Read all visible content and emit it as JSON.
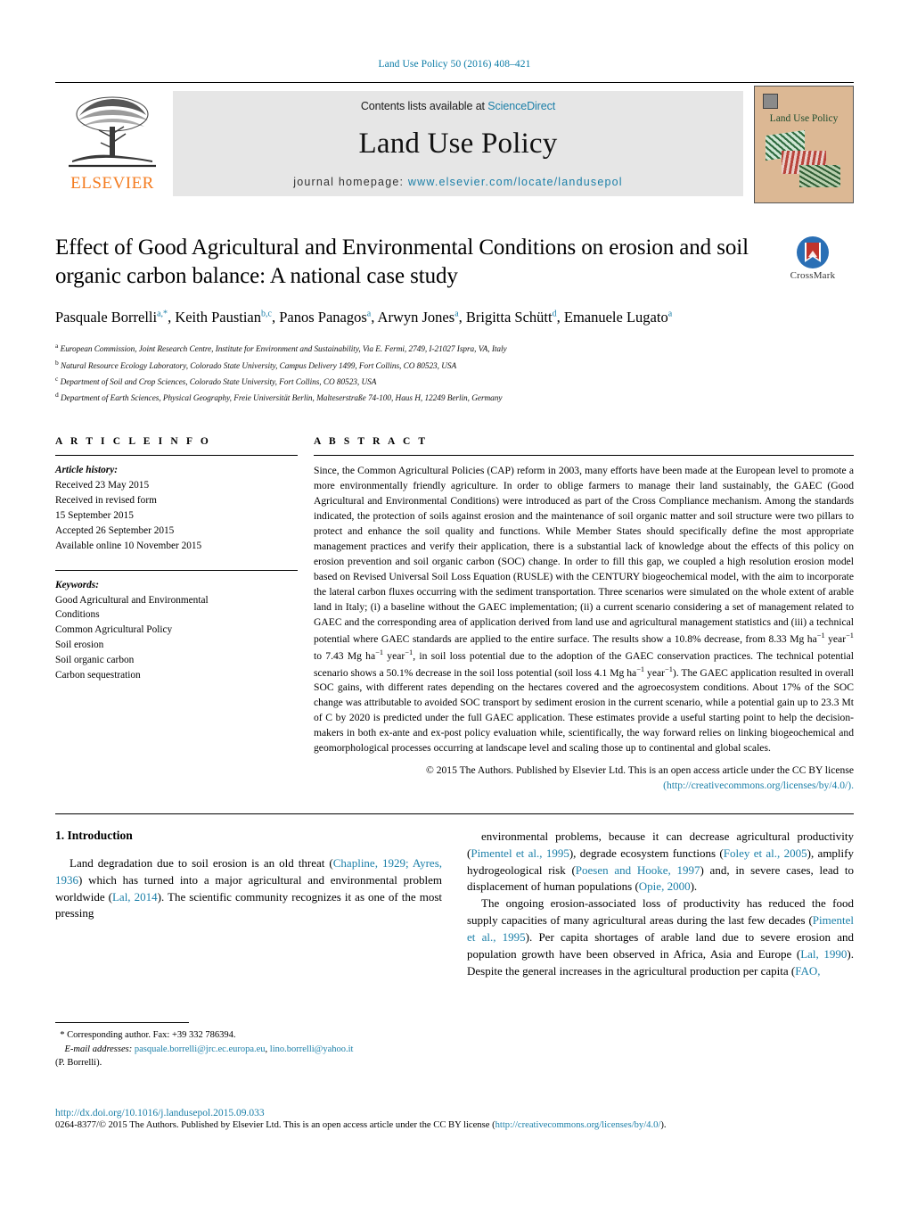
{
  "running_head": "Land Use Policy 50 (2016) 408–421",
  "masthead": {
    "publisher": "ELSEVIER",
    "contents_prefix": "Contents lists available at ",
    "contents_link": "ScienceDirect",
    "journal_name": "Land Use Policy",
    "homepage_prefix": "journal homepage: ",
    "homepage_url": "www.elsevier.com/locate/landusepol",
    "cover_title": "Land Use Policy"
  },
  "article": {
    "title": "Effect of Good Agricultural and Environmental Conditions on erosion and soil organic carbon balance: A national case study",
    "authors_html": "Pasquale Borrelli<sup>a,*</sup>, Keith Paustian<sup>b,c</sup>, Panos Panagos<sup>a</sup>, Arwyn Jones<sup>a</sup>, Brigitta Schütt<sup>d</sup>, Emanuele Lugato<sup>a</sup>",
    "crossmark_label": "CrossMark",
    "affiliations": [
      "European Commission, Joint Research Centre, Institute for Environment and Sustainability, Via E. Fermi, 2749, I-21027 Ispra, VA, Italy",
      "Natural Resource Ecology Laboratory, Colorado State University, Campus Delivery 1499, Fort Collins, CO 80523, USA",
      "Department of Soil and Crop Sciences, Colorado State University, Fort Collins, CO 80523, USA",
      "Department of Earth Sciences, Physical Geography, Freie Universität Berlin, Malteserstraße 74-100, Haus H, 12249 Berlin, Germany"
    ],
    "affiliation_marks": [
      "a",
      "b",
      "c",
      "d"
    ]
  },
  "article_info": {
    "heading": "A R T I C L E   I N F O",
    "history_label": "Article history:",
    "history_lines": [
      "Received 23 May 2015",
      "Received in revised form",
      "15 September 2015",
      "Accepted 26 September 2015",
      "Available online 10 November 2015"
    ],
    "keywords_label": "Keywords:",
    "keywords": [
      "Good Agricultural and Environmental",
      "Conditions",
      "Common Agricultural Policy",
      "Soil erosion",
      "Soil organic carbon",
      "Carbon sequestration"
    ]
  },
  "abstract": {
    "heading": "A B S T R A C T",
    "text_html": "Since, the Common Agricultural Policies (CAP) reform in 2003, many efforts have been made at the European level to promote a more environmentally friendly agriculture. In order to oblige farmers to manage their land sustainably, the GAEC (Good Agricultural and Environmental Conditions) were introduced as part of the Cross Compliance mechanism. Among the standards indicated, the protection of soils against erosion and the maintenance of soil organic matter and soil structure were two pillars to protect and enhance the soil quality and functions. While Member States should specifically define the most appropriate management practices and verify their application, there is a substantial lack of knowledge about the effects of this policy on erosion prevention and soil organic carbon (SOC) change. In order to fill this gap, we coupled a high resolution erosion model based on Revised Universal Soil Loss Equation (RUSLE) with the CENTURY biogeochemical model, with the aim to incorporate the lateral carbon fluxes occurring with the sediment transportation. Three scenarios were simulated on the whole extent of arable land in Italy; (i) a baseline without the GAEC implementation; (ii) a current scenario considering a set of management related to GAEC and the corresponding area of application derived from land use and agricultural management statistics and (iii) a technical potential where GAEC standards are applied to the entire surface. The results show a 10.8% decrease, from 8.33 Mg ha<sup>−1</sup> year<sup>−1</sup> to 7.43 Mg ha<sup>−1</sup> year<sup>−1</sup>, in soil loss potential due to the adoption of the GAEC conservation practices. The technical potential scenario shows a 50.1% decrease in the soil loss potential (soil loss 4.1 Mg ha<sup>−1</sup> year<sup>−1</sup>). The GAEC application resulted in overall SOC gains, with different rates depending on the hectares covered and the agroecosystem conditions. About 17% of the SOC change was attributable to avoided SOC transport by sediment erosion in the current scenario, while a potential gain up to 23.3 Mt of C by 2020 is predicted under the full GAEC application. These estimates provide a useful starting point to help the decision-makers in both ex-ante and ex-post policy evaluation while, scientifically, the way forward relies on linking biogeochemical and geomorphological processes occurring at landscape level and scaling those up to continental and global scales.",
    "copyright_text": "© 2015 The Authors. Published by Elsevier Ltd. This is an open access article under the CC BY license",
    "copyright_link": "http://creativecommons.org/licenses/by/4.0/"
  },
  "body": {
    "section_number_title": "1.  Introduction",
    "left_paragraph_html": "Land degradation due to soil erosion is an old threat (<span class=\"link\">Chapline, 1929; Ayres, 1936</span>) which has turned into a major agricultural and environmental problem worldwide (<span class=\"link\">Lal, 2014</span>). The scientific community recognizes it as one of the most pressing",
    "right_paragraph_1_html": "environmental problems, because it can decrease agricultural productivity (<span class=\"link\">Pimentel et al., 1995</span>), degrade ecosystem functions (<span class=\"link\">Foley et al., 2005</span>), amplify hydrogeological risk (<span class=\"link\">Poesen and Hooke, 1997</span>) and, in severe cases, lead to displacement of human populations (<span class=\"link\">Opie, 2000</span>).",
    "right_paragraph_2_html": "The ongoing erosion-associated loss of productivity has reduced the food supply capacities of many agricultural areas during the last few decades (<span class=\"link\">Pimentel et al., 1995</span>). Per capita shortages of arable land due to severe erosion and population growth have been observed in Africa, Asia and Europe (<span class=\"link\">Lal, 1990</span>). Despite the general increases in the agricultural production per capita (<span class=\"link\">FAO,</span>"
  },
  "footnote": {
    "corresponding_html": "* Corresponding author. Fax: +39 332 786394.",
    "email_label": "E-mail addresses:",
    "emails": [
      "pasquale.borrelli@jrc.ec.europa.eu",
      "lino.borrelli@yahoo.it"
    ],
    "email_owner": "(P. Borrelli)."
  },
  "footer": {
    "doi": "http://dx.doi.org/10.1016/j.landusepol.2015.09.033",
    "issn_line_html": "0264-8377/© 2015 The Authors. Published by Elsevier Ltd. This is an open access article under the CC BY license (<span class=\"link\">http://creativecommons.org/licenses/by/4.0/</span>).",
    "issn_prefix": "0264-8377/© 2015 The Authors. Published by Elsevier Ltd. This is an open access article under the CC BY license (",
    "issn_link": "http://creativecommons.org/licenses/by/4.0/",
    "issn_suffix": ")."
  },
  "colors": {
    "link": "#1b7fa8",
    "elsevier_orange": "#f47c20",
    "band_gray": "#e6e6e6",
    "cover_tan": "#dcb894",
    "crossmark_blue": "#2a6fb5",
    "crossmark_red": "#c1342c"
  }
}
